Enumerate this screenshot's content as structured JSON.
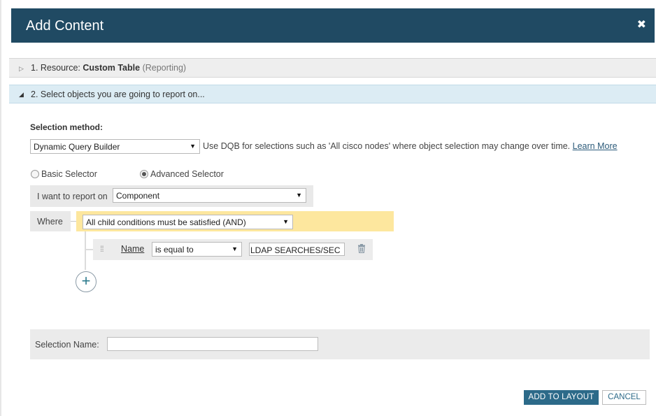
{
  "dialog": {
    "title": "Add Content",
    "close_glyph": "✖"
  },
  "steps": {
    "step1": {
      "arrow": "▷",
      "prefix": "1. Resource: ",
      "resource_name": "Custom Table",
      "resource_sub": "(Reporting)"
    },
    "step2": {
      "arrow": "◢",
      "label": "2. Select objects you are going to report on..."
    }
  },
  "selection": {
    "method_label": "Selection method:",
    "method_value": "Dynamic Query Builder",
    "method_help": "Use DQB for selections such as 'All cisco nodes' where object selection may change over time.",
    "learn_more": "Learn More",
    "radio_basic": "Basic Selector",
    "radio_advanced": "Advanced Selector",
    "selected_radio": "advanced",
    "report_on_label": "I want to report on",
    "report_on_value": "Component",
    "where_label": "Where",
    "group_condition": "All child conditions must be satisfied (AND)",
    "condition": {
      "field": "Name",
      "operator": "is equal to",
      "value": "LDAP SEARCHES/SEC"
    },
    "add_glyph": "+",
    "name_label": "Selection Name:",
    "name_value": ""
  },
  "buttons": {
    "add_to_layout": "ADD TO LAYOUT",
    "cancel": "CANCEL"
  },
  "icons": {
    "close": "close-icon",
    "drag": "drag-handle-icon",
    "trash": "trash-icon",
    "caret": "caret-down-icon",
    "add": "plus-circle-icon"
  },
  "colors": {
    "titlebar": "#204a63",
    "step_active": "#dcecf4",
    "and_group": "#fde79e",
    "primary_button": "#2c6a89"
  }
}
